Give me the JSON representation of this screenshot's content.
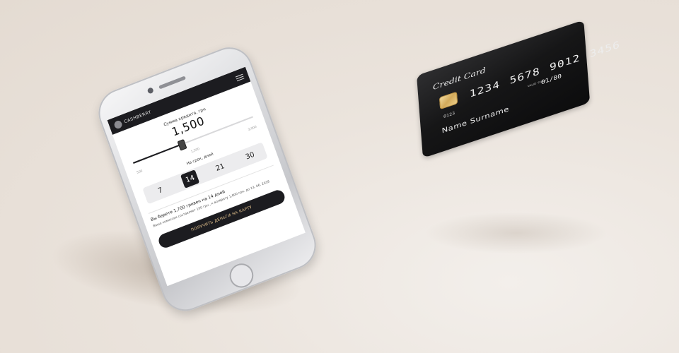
{
  "app": {
    "logo_text": "CASHBERRY"
  },
  "loan": {
    "amount_label": "Сумма кредита, грн",
    "amount_value": "1,500",
    "slider_ticks": [
      "500",
      "1,500",
      "3,000"
    ],
    "slider_level_fraction": 0.4
  },
  "term": {
    "label": "На срок, дней",
    "options": [
      "7",
      "14",
      "21",
      "30"
    ],
    "selected": "14"
  },
  "summary": {
    "text": "Вы берете 1,700 гривен на 14 дней",
    "fee_text": "Ваша комиссия составляет 100 грн., к возврату 1,800 грн. до 13. 06. 2018"
  },
  "cta": {
    "label": "ПОЛУЧИТЬ ДЕНЬГИ НА КАРТУ"
  },
  "card": {
    "title": "Credit Card",
    "number_groups": [
      "1234",
      "5678",
      "9012",
      "3456"
    ],
    "small_number": "0123",
    "valid_thru": "VALID THRU",
    "expiry": "01/80",
    "holder": "Name Surname"
  },
  "colors": {
    "background": "#ebe4dd",
    "phone_silver": "#d9dadd",
    "app_dark": "#1c1c20",
    "cta_text_gold": "#e6c48f",
    "card_black": "#161617",
    "chip_gold": "#d3aa5a"
  }
}
